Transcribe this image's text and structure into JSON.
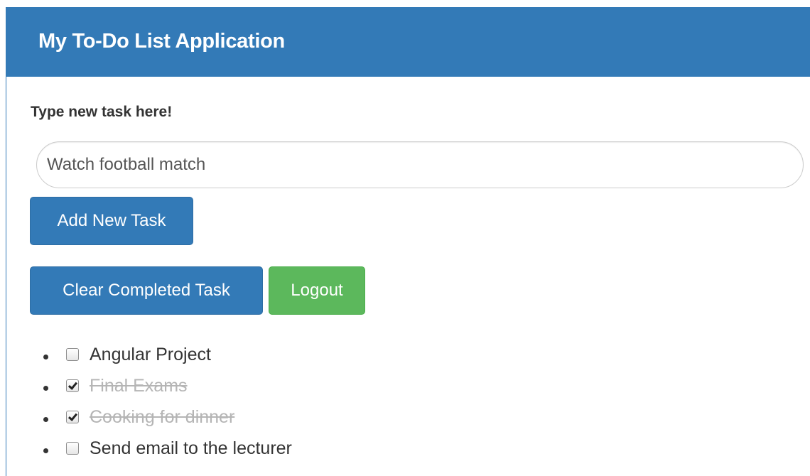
{
  "header": {
    "title": "My To-Do List Application"
  },
  "form": {
    "label": "Type new task here!",
    "input_value": "Watch football match",
    "add_button_label": "Add New Task"
  },
  "actions": {
    "clear_button_label": "Clear Completed Task",
    "logout_button_label": "Logout"
  },
  "tasks": [
    {
      "label": "Angular Project",
      "completed": false
    },
    {
      "label": "Final Exams",
      "completed": true
    },
    {
      "label": "Cooking for dinner",
      "completed": true
    },
    {
      "label": "Send email to the lecturer",
      "completed": false
    }
  ],
  "colors": {
    "primary": "#337ab7",
    "success": "#5cb85c",
    "completed_text": "#b5b5b5"
  }
}
